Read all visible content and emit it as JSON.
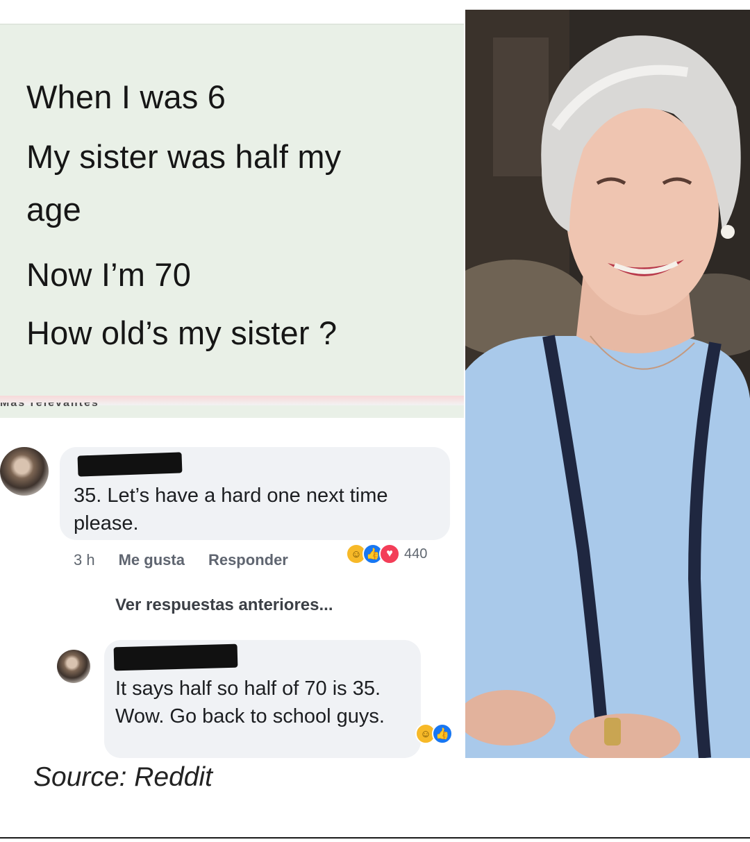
{
  "question": {
    "lines": [
      "When I was 6",
      "My sister was half my",
      "age",
      "Now I’m 70",
      "How old’s my sister ?"
    ],
    "cut_text": "Más relevantes"
  },
  "comment1": {
    "text": "35. Let’s have a hard one next time please.",
    "time": "3 h",
    "like_label": "Me gusta",
    "reply_label": "Responder",
    "reaction_count": "440",
    "reaction_icons": [
      "haha-icon",
      "like-icon",
      "love-icon"
    ]
  },
  "previous_replies": "Ver respuestas anteriores...",
  "comment2": {
    "text": "It says half so half of 70 is 35. Wow. Go back to school guys.",
    "reaction_icons": [
      "haha-icon",
      "like-icon"
    ]
  },
  "caption": "Source: Reddit",
  "colors": {
    "card_bg": "#e9f0e7",
    "bubble_bg": "#f0f2f5",
    "like_blue": "#1877f2",
    "love_red": "#f33e58",
    "haha_yellow": "#f7b928"
  }
}
